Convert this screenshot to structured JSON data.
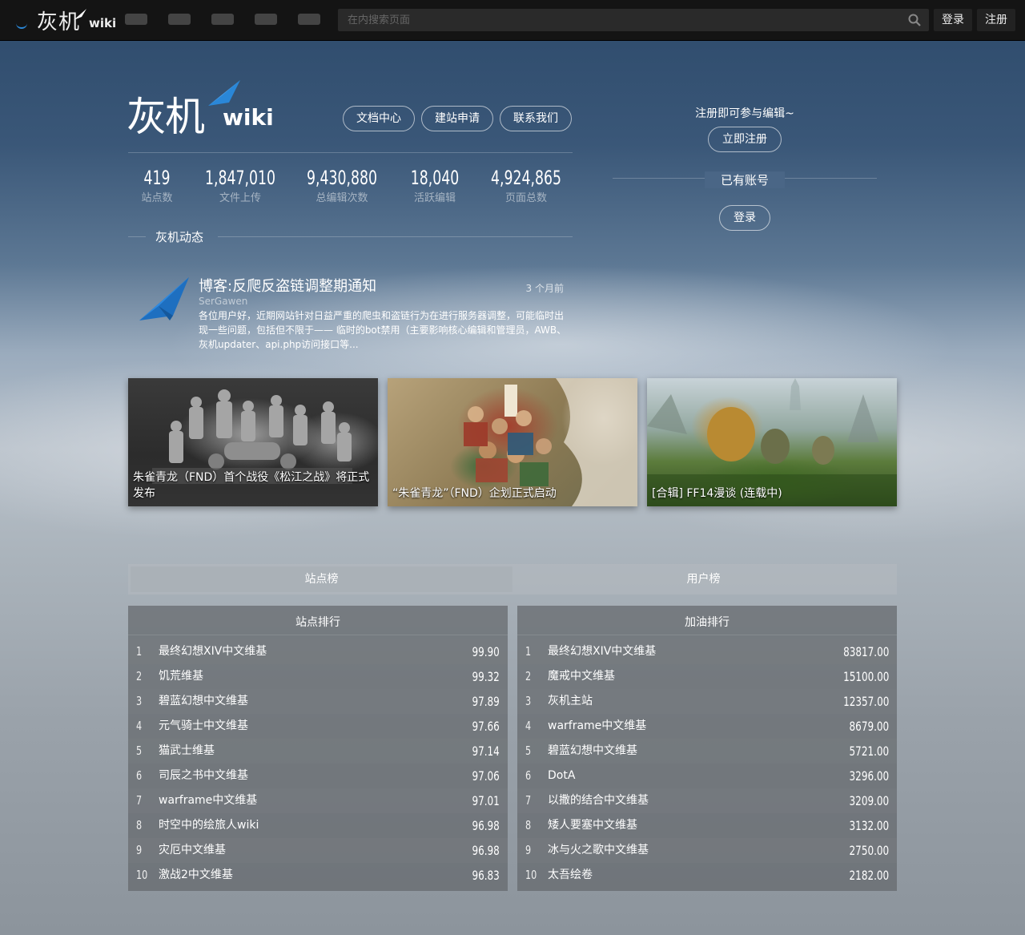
{
  "topbar": {
    "logo_cn": "灰机",
    "logo_en": "wiki",
    "search_placeholder": "在内搜索页面",
    "login": "登录",
    "register": "注册"
  },
  "hero": {
    "logo_cn": "灰机",
    "logo_en": "wiki",
    "buttons": [
      "文档中心",
      "建站申请",
      "联系我们"
    ],
    "stats": [
      {
        "value": "419",
        "label": "站点数"
      },
      {
        "value": "1,847,010",
        "label": "文件上传"
      },
      {
        "value": "9,430,880",
        "label": "总编辑次数"
      },
      {
        "value": "18,040",
        "label": "活跃编辑"
      },
      {
        "value": "4,924,865",
        "label": "页面总数"
      }
    ],
    "news_section": "灰机动态"
  },
  "side": {
    "prompt": "注册即可参与编辑~",
    "register_button": "立即注册",
    "have_account": "已有账号",
    "login_button": "登录"
  },
  "news": {
    "title": "博客:反爬反盗链调整期通知",
    "author": "SerGawen",
    "time": "3 个月前",
    "body": "各位用户好，近期网站针对日益严重的爬虫和盗链行为在进行服务器调整，可能临时出现一些问题，包括但不限于—— 临时的bot禁用（主要影响核心编辑和管理员，AWB、灰机updater、api.php访问接口等..."
  },
  "cards": [
    {
      "caption": "朱雀青龙（FND）首个战役《松江之战》将正式发布"
    },
    {
      "caption": "“朱雀青龙”（FND）企划正式启动"
    },
    {
      "caption": "[合辑] FF14漫谈 (连载中)"
    }
  ],
  "tabs": [
    "站点榜",
    "用户榜"
  ],
  "rank_left": {
    "title": "站点排行",
    "rows": [
      {
        "n": "1",
        "name": "最终幻想XIV中文维基",
        "score": "99.90"
      },
      {
        "n": "2",
        "name": "饥荒维基",
        "score": "99.32"
      },
      {
        "n": "3",
        "name": "碧蓝幻想中文维基",
        "score": "97.89"
      },
      {
        "n": "4",
        "name": "元气骑士中文维基",
        "score": "97.66"
      },
      {
        "n": "5",
        "name": "猫武士维基",
        "score": "97.14"
      },
      {
        "n": "6",
        "name": "司辰之书中文维基",
        "score": "97.06"
      },
      {
        "n": "7",
        "name": "warframe中文维基",
        "score": "97.01"
      },
      {
        "n": "8",
        "name": "时空中的绘旅人wiki",
        "score": "96.98"
      },
      {
        "n": "9",
        "name": "灾厄中文维基",
        "score": "96.98"
      },
      {
        "n": "10",
        "name": "激战2中文维基",
        "score": "96.83"
      }
    ]
  },
  "rank_right": {
    "title": "加油排行",
    "rows": [
      {
        "n": "1",
        "name": "最终幻想XIV中文维基",
        "score": "83817.00"
      },
      {
        "n": "2",
        "name": "魔戒中文维基",
        "score": "15100.00"
      },
      {
        "n": "3",
        "name": "灰机主站",
        "score": "12357.00"
      },
      {
        "n": "4",
        "name": "warframe中文维基",
        "score": "8679.00"
      },
      {
        "n": "5",
        "name": "碧蓝幻想中文维基",
        "score": "5721.00"
      },
      {
        "n": "6",
        "name": "DotA",
        "score": "3296.00"
      },
      {
        "n": "7",
        "name": "以撒的结合中文维基",
        "score": "3209.00"
      },
      {
        "n": "8",
        "name": "矮人要塞中文维基",
        "score": "3132.00"
      },
      {
        "n": "9",
        "name": "冰与火之歌中文维基",
        "score": "2750.00"
      },
      {
        "n": "10",
        "name": "太吾绘卷",
        "score": "2182.00"
      }
    ]
  },
  "colors": {
    "accent": "#2a87d8",
    "topbar": "#141414"
  },
  "icons": {
    "search": "magnifier-icon",
    "logo": "paper-plane-icon"
  }
}
